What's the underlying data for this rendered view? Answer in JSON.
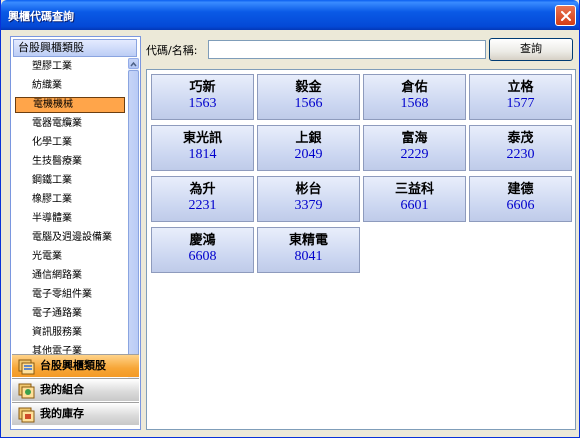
{
  "window": {
    "title": "興櫃代碼查詢"
  },
  "sidebar": {
    "header": "台股興櫃類股",
    "categories": [
      {
        "label": "塑膠工業",
        "selected": false
      },
      {
        "label": "紡織業",
        "selected": false
      },
      {
        "label": "電機機械",
        "selected": true
      },
      {
        "label": "電器電纜業",
        "selected": false
      },
      {
        "label": "化學工業",
        "selected": false
      },
      {
        "label": "生技醫療業",
        "selected": false
      },
      {
        "label": "鋼鐵工業",
        "selected": false
      },
      {
        "label": "橡膠工業",
        "selected": false
      },
      {
        "label": "半導體業",
        "selected": false
      },
      {
        "label": "電腦及週邊設備業",
        "selected": false
      },
      {
        "label": "光電業",
        "selected": false
      },
      {
        "label": "通信網路業",
        "selected": false
      },
      {
        "label": "電子零組件業",
        "selected": false
      },
      {
        "label": "電子通路業",
        "selected": false
      },
      {
        "label": "資訊服務業",
        "selected": false
      },
      {
        "label": "其他電子業",
        "selected": false
      }
    ],
    "nav": [
      {
        "label": "台股興櫃類股",
        "active": true,
        "icon": "category-icon"
      },
      {
        "label": "我的組合",
        "active": false,
        "icon": "portfolio-icon"
      },
      {
        "label": "我的庫存",
        "active": false,
        "icon": "inventory-icon"
      }
    ]
  },
  "search": {
    "label": "代碼/名稱:",
    "value": "",
    "button": "查詢"
  },
  "stocks": [
    {
      "name": "巧新",
      "code": "1563"
    },
    {
      "name": "毅金",
      "code": "1566"
    },
    {
      "name": "倉佑",
      "code": "1568"
    },
    {
      "name": "立格",
      "code": "1577"
    },
    {
      "name": "東光訊",
      "code": "1814"
    },
    {
      "name": "上銀",
      "code": "2049"
    },
    {
      "name": "富海",
      "code": "2229"
    },
    {
      "name": "泰茂",
      "code": "2230"
    },
    {
      "name": "為升",
      "code": "2231"
    },
    {
      "name": "彬台",
      "code": "3379"
    },
    {
      "name": "三益科",
      "code": "6601"
    },
    {
      "name": "建德",
      "code": "6606"
    },
    {
      "name": "慶鴻",
      "code": "6608"
    },
    {
      "name": "東精電",
      "code": "8041"
    }
  ],
  "colors": {
    "title_bar": "#0a5ae6",
    "selected_item": "#ffa54a",
    "code_text": "#0000cc",
    "tile_bg": "#cad5f0"
  }
}
